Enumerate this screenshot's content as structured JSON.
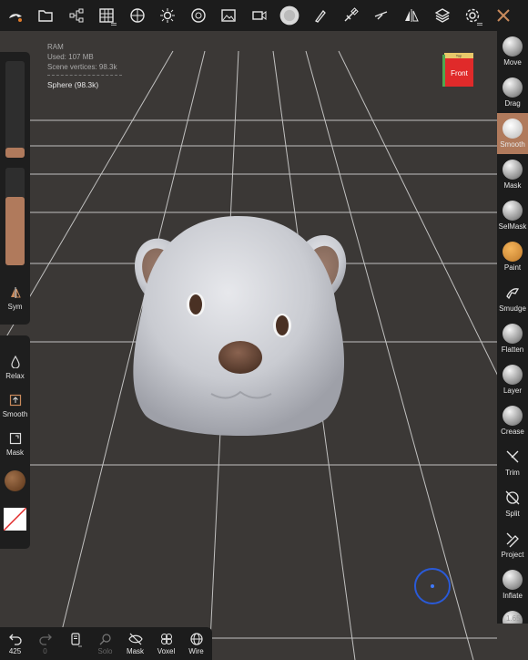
{
  "stats": {
    "ram_label": "RAM",
    "used": "Used: 107 MB",
    "scene_vertices": "Scene vertices: 98.3k",
    "object": "Sphere (98.3k)"
  },
  "view_cube": {
    "front": "Front",
    "top": "Top"
  },
  "top_toolbar": [
    {
      "name": "logo-icon"
    },
    {
      "name": "files-icon"
    },
    {
      "name": "scene-icon"
    },
    {
      "name": "grid-icon"
    },
    {
      "name": "material-icon"
    },
    {
      "name": "light-icon"
    },
    {
      "name": "camera-lens-icon"
    },
    {
      "name": "image-icon"
    },
    {
      "name": "video-icon"
    },
    {
      "name": "sculpt-brush-icon"
    },
    {
      "name": "brush-icon"
    },
    {
      "name": "stroke-icon"
    },
    {
      "name": "pen-icon"
    },
    {
      "name": "symmetry-icon"
    },
    {
      "name": "layers-icon"
    },
    {
      "name": "settings-icon"
    },
    {
      "name": "tools-icon"
    }
  ],
  "left_panel": {
    "sym_label": "Sym",
    "relax_label": "Relax",
    "smooth_label": "Smooth",
    "mask_label": "Mask",
    "radius_fill": 0.1,
    "intensity_fill": 0.7,
    "color_swatch": "#7a4a2c"
  },
  "right_tools": [
    {
      "label": "Move"
    },
    {
      "label": "Drag"
    },
    {
      "label": "Smooth",
      "active": true
    },
    {
      "label": "Mask"
    },
    {
      "label": "SelMask"
    },
    {
      "label": "Paint"
    },
    {
      "label": "Smudge"
    },
    {
      "label": "Flatten"
    },
    {
      "label": "Layer"
    },
    {
      "label": "Crease"
    },
    {
      "label": "Trim"
    },
    {
      "label": "Split"
    },
    {
      "label": "Project"
    },
    {
      "label": "Inflate"
    }
  ],
  "bottom_bar": {
    "undo_count": "425",
    "redo_count": "0",
    "solo_label": "Solo",
    "mask_label": "Mask",
    "voxel_label": "Voxel",
    "wire_label": "Wire"
  },
  "zoom_value": "1.65",
  "colors": {
    "accent": "#b07a5c",
    "background": "#3b3836",
    "panel": "#1c1c1c",
    "gizmo": "#2a5ad8"
  }
}
